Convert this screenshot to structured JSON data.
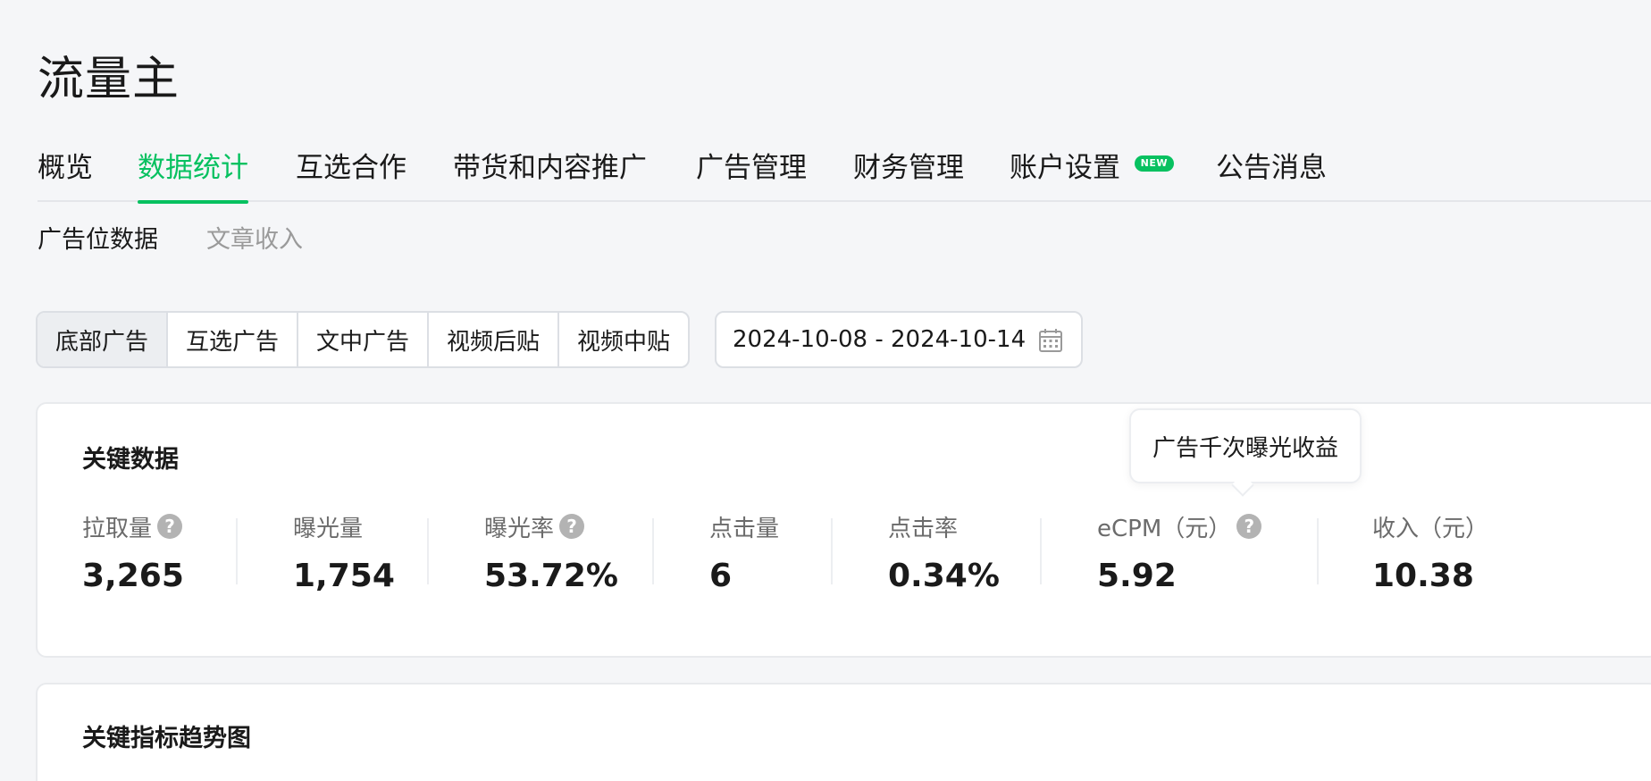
{
  "app": {
    "title": "流量主"
  },
  "main_nav": {
    "tabs": [
      {
        "label": "概览"
      },
      {
        "label": "数据统计",
        "active": true
      },
      {
        "label": "互选合作"
      },
      {
        "label": "带货和内容推广"
      },
      {
        "label": "广告管理"
      },
      {
        "label": "财务管理"
      },
      {
        "label": "账户设置",
        "badge": "NEW"
      },
      {
        "label": "公告消息"
      }
    ]
  },
  "sub_nav": {
    "tabs": [
      {
        "label": "广告位数据",
        "active": true
      },
      {
        "label": "文章收入"
      }
    ]
  },
  "ad_types": {
    "options": [
      "底部广告",
      "互选广告",
      "文中广告",
      "视频后贴",
      "视频中贴"
    ],
    "selected": "底部广告"
  },
  "date_range": {
    "value": "2024-10-08 - 2024-10-14"
  },
  "key_data": {
    "title": "关键数据",
    "metrics": [
      {
        "label": "拉取量",
        "value": "3,265"
      },
      {
        "label": "曝光量",
        "value": "1,754"
      },
      {
        "label": "曝光率",
        "value": "53.72%"
      },
      {
        "label": "点击量",
        "value": "6"
      },
      {
        "label": "点击率",
        "value": "0.34%"
      },
      {
        "label": "eCPM（元）",
        "value": "5.92"
      },
      {
        "label": "收入（元）",
        "value": "10.38"
      }
    ],
    "tooltip": "广告千次曝光收益"
  },
  "trend": {
    "title": "关键指标趋势图"
  },
  "colors": {
    "accent": "#07c160",
    "muted_text": "#9a9a9a"
  }
}
